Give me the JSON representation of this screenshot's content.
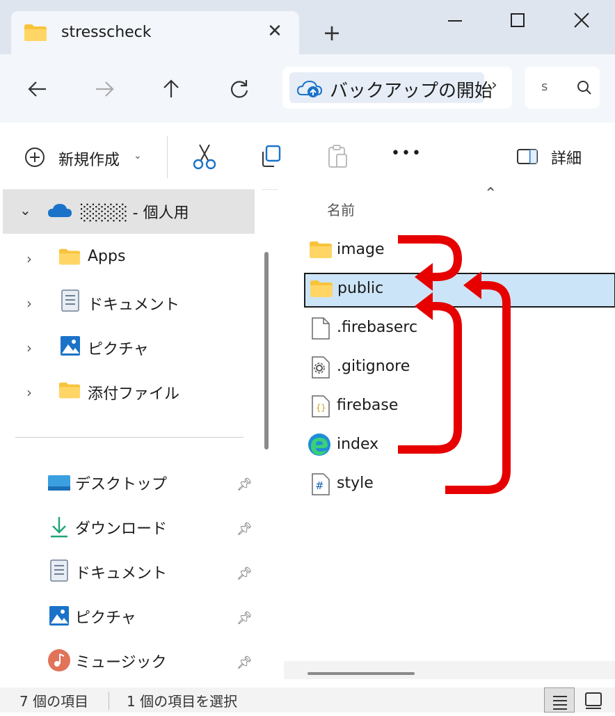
{
  "window": {
    "tab_title": "stresscheck",
    "tab_close": "✕",
    "new_tab": "+",
    "minimize": "—",
    "maximize": "☐",
    "close": "✕"
  },
  "address": {
    "location": "バックアップの開始",
    "search_placeholder": "s"
  },
  "commands": {
    "new_label": "新規作成",
    "more": "•••",
    "details_label": "詳細"
  },
  "sidebar": {
    "account": "░░░░ - 個人用",
    "tree": [
      {
        "label": "Apps",
        "icon": "folder-icon"
      },
      {
        "label": "ドキュメント",
        "icon": "document-icon"
      },
      {
        "label": "ピクチャ",
        "icon": "picture-icon"
      },
      {
        "label": "添付ファイル",
        "icon": "folder-icon"
      }
    ],
    "quick_access": [
      {
        "label": "デスクトップ",
        "icon": "desktop-icon"
      },
      {
        "label": "ダウンロード",
        "icon": "download-icon"
      },
      {
        "label": "ドキュメント",
        "icon": "document-icon"
      },
      {
        "label": "ピクチャ",
        "icon": "picture-icon"
      },
      {
        "label": "ミュージック",
        "icon": "music-icon"
      }
    ]
  },
  "files": {
    "column_name": "名前",
    "items": [
      {
        "name": "image",
        "icon": "folder-icon"
      },
      {
        "name": "public",
        "icon": "folder-icon",
        "selected": true
      },
      {
        "name": ".firebaserc",
        "icon": "file-icon"
      },
      {
        "name": ".gitignore",
        "icon": "settings-file-icon"
      },
      {
        "name": "firebase",
        "icon": "json-file-icon"
      },
      {
        "name": "index",
        "icon": "edge-html-icon"
      },
      {
        "name": "style",
        "icon": "css-file-icon"
      }
    ]
  },
  "status": {
    "item_count": "7 個の項目",
    "selected_count": "1 個の項目を選択"
  },
  "colors": {
    "accent": "#0067c0",
    "folder": "#f8c43c",
    "annotation_arrow": "#e60000",
    "selection": "#cce4f7"
  }
}
